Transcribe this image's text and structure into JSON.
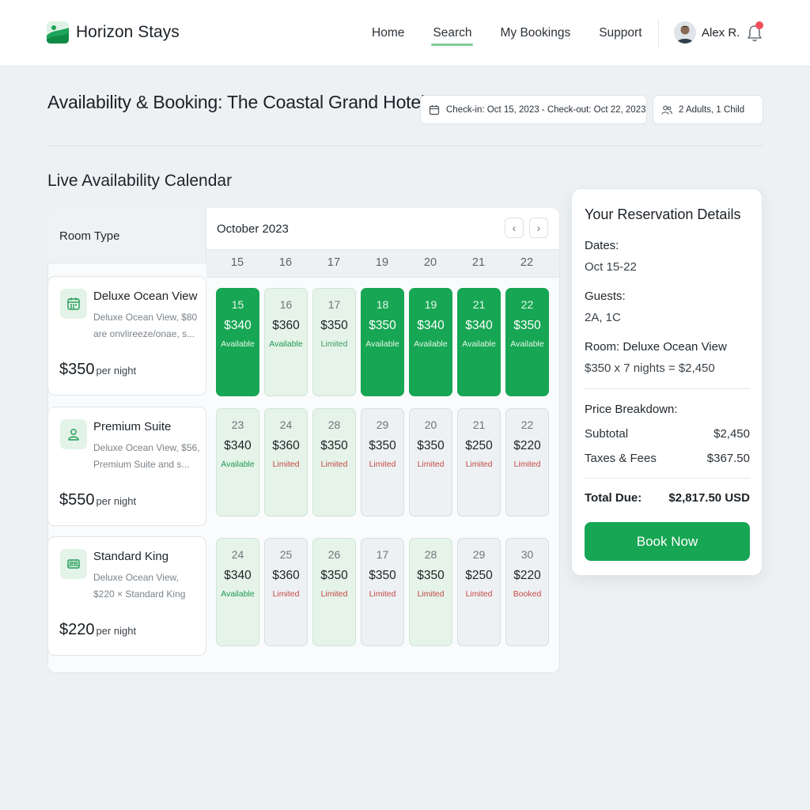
{
  "brand": {
    "name": "Horizon Stays"
  },
  "nav": [
    {
      "label": "Home",
      "active": false
    },
    {
      "label": "Search",
      "active": true
    },
    {
      "label": "My Bookings",
      "active": false
    },
    {
      "label": "Support",
      "active": false
    }
  ],
  "user": {
    "name": "Alex R.",
    "has_notification": true
  },
  "page": {
    "title": "Availability & Booking: The Coastal Grand Hotel",
    "dates_pill": "Check-in: Oct 15, 2023 - Check-out: Oct 22, 2023",
    "guests_pill": "2 Adults, 1 Child"
  },
  "calendar": {
    "section_title": "Live Availability Calendar",
    "room_type_header": "Room Type",
    "month": "October 2023",
    "prev_icon": "chevron-left-icon",
    "next_icon": "chevron-right-icon",
    "day_headers": [
      "15",
      "16",
      "17",
      "19",
      "20",
      "21",
      "22"
    ],
    "rooms": [
      {
        "name": "Deluxe Ocean View",
        "desc_lines": [
          "Deluxe Ocean View, $80",
          "are onvlireeze/onae, s..."
        ],
        "price": "$350",
        "per": "per night",
        "icon": "calendar-icon",
        "cells": [
          {
            "day": "15",
            "price": "$340",
            "status": "Available",
            "style": "green"
          },
          {
            "day": "16",
            "price": "$360",
            "status": "Available",
            "style": "lgreen"
          },
          {
            "day": "17",
            "price": "$350",
            "status": "Limited",
            "style": "lgreen"
          },
          {
            "day": "18",
            "price": "$350",
            "status": "Available",
            "style": "green"
          },
          {
            "day": "19",
            "price": "$340",
            "status": "Available",
            "style": "green"
          },
          {
            "day": "21",
            "price": "$340",
            "status": "Available",
            "style": "green"
          },
          {
            "day": "22",
            "price": "$350",
            "status": "Available",
            "style": "green"
          }
        ]
      },
      {
        "name": "Premium Suite",
        "desc_lines": [
          "Deluxe Ocean View, $56,",
          "Premium Suite and s..."
        ],
        "price": "$550",
        "per": "per night",
        "icon": "user-icon",
        "cells": [
          {
            "day": "23",
            "price": "$340",
            "status": "Available",
            "style": "lgreen"
          },
          {
            "day": "24",
            "price": "$360",
            "status": "Limited",
            "style": "lgreen"
          },
          {
            "day": "28",
            "price": "$350",
            "status": "Limited",
            "style": "lgreen"
          },
          {
            "day": "29",
            "price": "$350",
            "status": "Limited",
            "style": "gray"
          },
          {
            "day": "20",
            "price": "$350",
            "status": "Limited",
            "style": "gray"
          },
          {
            "day": "21",
            "price": "$250",
            "status": "Limited",
            "style": "gray"
          },
          {
            "day": "22",
            "price": "$220",
            "status": "Limited",
            "style": "gray"
          }
        ]
      },
      {
        "name": "Standard King",
        "desc_lines": [
          "Deluxe Ocean View,",
          "$220 × Standard King"
        ],
        "price": "$220",
        "per": "per night",
        "icon": "bed-icon",
        "cells": [
          {
            "day": "24",
            "price": "$340",
            "status": "Available",
            "style": "lgreen"
          },
          {
            "day": "25",
            "price": "$360",
            "status": "Limited",
            "style": "gray"
          },
          {
            "day": "26",
            "price": "$350",
            "status": "Limited",
            "style": "lgreen"
          },
          {
            "day": "17",
            "price": "$350",
            "status": "Limited",
            "style": "gray"
          },
          {
            "day": "28",
            "price": "$350",
            "status": "Limited",
            "style": "lgreen"
          },
          {
            "day": "29",
            "price": "$250",
            "status": "Limited",
            "style": "gray"
          },
          {
            "day": "30",
            "price": "$220",
            "status": "Booked",
            "style": "gray"
          }
        ]
      }
    ]
  },
  "reservation": {
    "title": "Your Reservation Details",
    "dates_label": "Dates:",
    "dates_value": "Oct 15-22",
    "guests_label": "Guests:",
    "guests_value": "2A, 1C",
    "room_label": "Room: Deluxe Ocean View",
    "room_calc": "$350 x 7 nights = $2,450",
    "breakdown_label": "Price Breakdown:",
    "subtotal_label": "Subtotal",
    "subtotal_value": "$2,450",
    "taxes_label": "Taxes & Fees",
    "taxes_value": "$367.50",
    "total_label": "Total Due:",
    "total_value": "$2,817.50 USD",
    "book_button": "Book Now"
  },
  "colors": {
    "accent": "#17a653",
    "accent_light": "#e5f3e8",
    "limited_text": "#c44a48",
    "notification": "#f04f5c"
  }
}
